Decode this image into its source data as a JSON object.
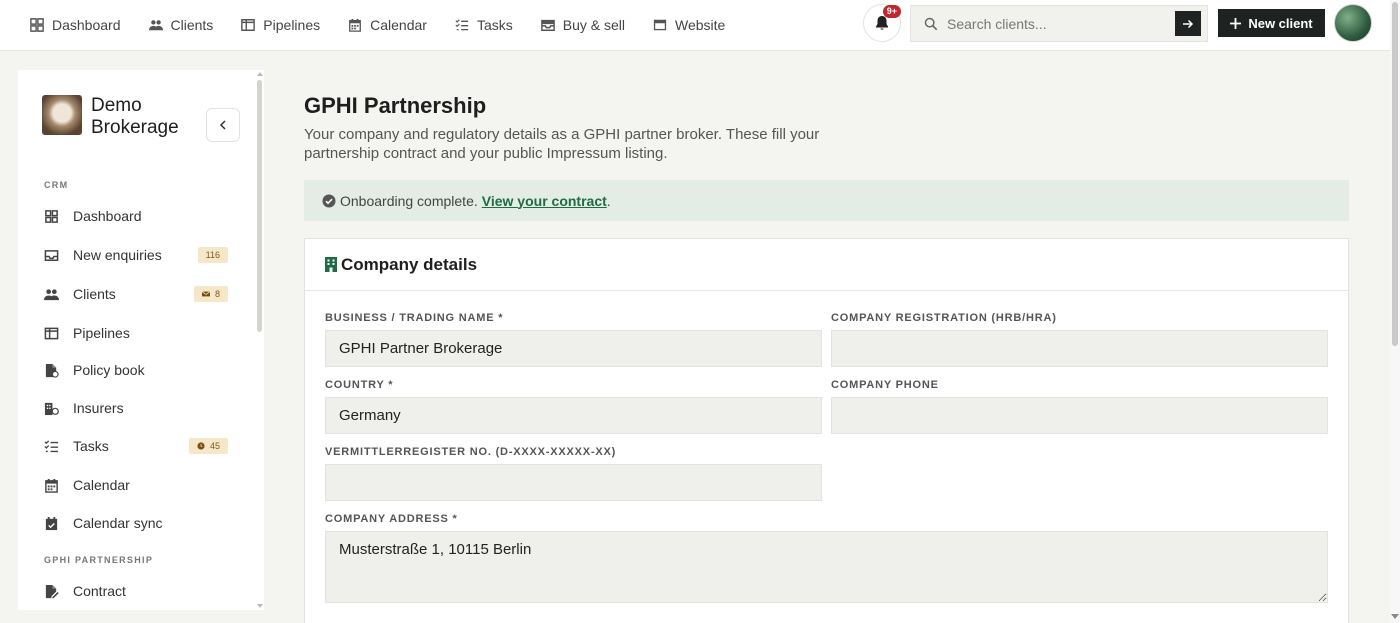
{
  "topnav": {
    "items": [
      {
        "label": "Dashboard",
        "icon": "grid-icon"
      },
      {
        "label": "Clients",
        "icon": "users-icon"
      },
      {
        "label": "Pipelines",
        "icon": "columns-icon"
      },
      {
        "label": "Calendar",
        "icon": "calendar-icon"
      },
      {
        "label": "Tasks",
        "icon": "tasks-icon"
      },
      {
        "label": "Buy & sell",
        "icon": "inbox-icon"
      },
      {
        "label": "Website",
        "icon": "window-icon"
      }
    ],
    "notifications_badge": "9+",
    "search_placeholder": "Search clients...",
    "new_client_label": "New client"
  },
  "sidebar": {
    "brand_name": "Demo Brokerage",
    "sections": {
      "crm": "CRM",
      "partnership": "GPHI PARTNERSHIP"
    },
    "items": [
      {
        "label": "Dashboard",
        "icon": "grid-icon"
      },
      {
        "label": "New enquiries",
        "icon": "inbox-icon",
        "badge": "116"
      },
      {
        "label": "Clients",
        "icon": "users-icon",
        "badge": "8",
        "badge_icon": "envelope-icon"
      },
      {
        "label": "Pipelines",
        "icon": "columns-icon"
      },
      {
        "label": "Policy book",
        "icon": "file-icon"
      },
      {
        "label": "Insurers",
        "icon": "building-icon"
      },
      {
        "label": "Tasks",
        "icon": "tasks-icon",
        "badge": "45",
        "badge_icon": "clock-icon"
      },
      {
        "label": "Calendar",
        "icon": "calendar-icon"
      },
      {
        "label": "Calendar sync",
        "icon": "calendar-check-icon"
      },
      {
        "label": "Contract",
        "icon": "file-signature-icon"
      }
    ]
  },
  "main": {
    "title": "GPHI Partnership",
    "subtitle": "Your company and regulatory details as a GPHI partner broker. These fill your partnership contract and your public Impressum listing.",
    "banner": {
      "text": "Onboarding complete.",
      "link": "View your contract",
      "suffix": "."
    },
    "card": {
      "title": "Company details",
      "fields": {
        "business_name": {
          "label": "BUSINESS / TRADING NAME *",
          "value": "GPHI Partner Brokerage"
        },
        "registration": {
          "label": "COMPANY REGISTRATION (HRB/HRA)",
          "value": ""
        },
        "country": {
          "label": "COUNTRY *",
          "value": "Germany"
        },
        "phone": {
          "label": "COMPANY PHONE",
          "value": ""
        },
        "vermittler": {
          "label": "VERMITTLERREGISTER NO. (D-XXXX-XXXXX-XX)",
          "value": ""
        },
        "address": {
          "label": "COMPANY ADDRESS *",
          "value": "Musterstraße 1, 10115 Berlin"
        }
      }
    }
  },
  "colors": {
    "primary_dark": "#1e2220",
    "banner_bg": "#e3ece5",
    "link_green": "#1f6b43",
    "badge_bg": "#f7e7c9",
    "notification_red": "#c0262d"
  }
}
